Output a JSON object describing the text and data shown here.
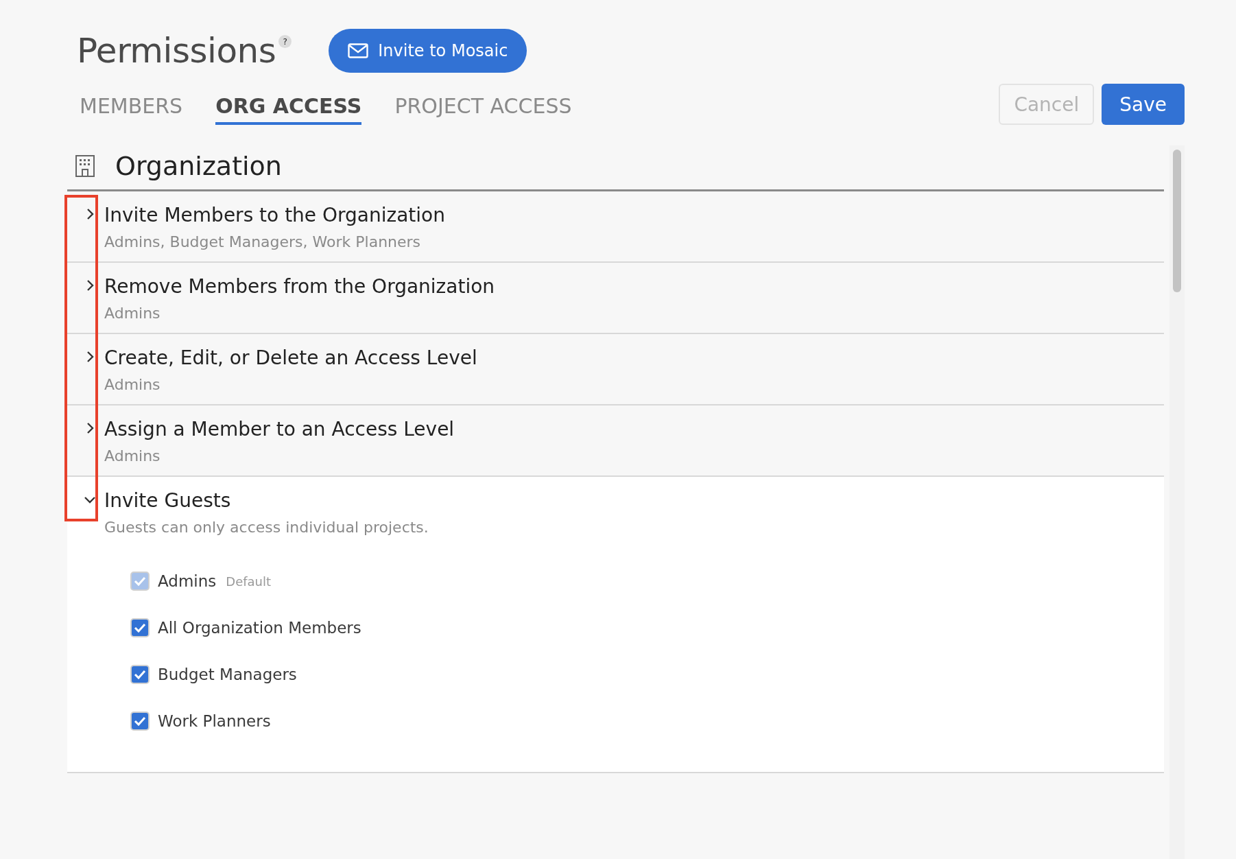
{
  "header": {
    "title": "Permissions",
    "help_badge": "?",
    "invite_button": "Invite to Mosaic"
  },
  "tabs": [
    {
      "label": "MEMBERS",
      "selected": false
    },
    {
      "label": "ORG ACCESS",
      "selected": true
    },
    {
      "label": "PROJECT ACCESS",
      "selected": false
    }
  ],
  "actions": {
    "cancel": {
      "label": "Cancel",
      "disabled": true
    },
    "save": {
      "label": "Save",
      "disabled": false
    }
  },
  "section": {
    "title": "Organization",
    "permissions": [
      {
        "title": "Invite Members to the Organization",
        "subtitle": "Admins, Budget Managers, Work Planners",
        "expanded": false
      },
      {
        "title": "Remove Members from the Organization",
        "subtitle": "Admins",
        "expanded": false
      },
      {
        "title": "Create, Edit, or Delete an Access Level",
        "subtitle": "Admins",
        "expanded": false
      },
      {
        "title": "Assign a Member to an Access Level",
        "subtitle": "Admins",
        "expanded": false
      },
      {
        "title": "Invite Guests",
        "subtitle": "Guests can only access individual projects.",
        "expanded": true,
        "options": [
          {
            "label": "Admins",
            "tag": "Default",
            "checked": true,
            "disabled": true
          },
          {
            "label": "All Organization Members",
            "checked": true,
            "disabled": false
          },
          {
            "label": "Budget Managers",
            "checked": true,
            "disabled": false
          },
          {
            "label": "Work Planners",
            "checked": true,
            "disabled": false
          }
        ]
      }
    ]
  },
  "annotation": {
    "highlight_chevrons": true
  }
}
